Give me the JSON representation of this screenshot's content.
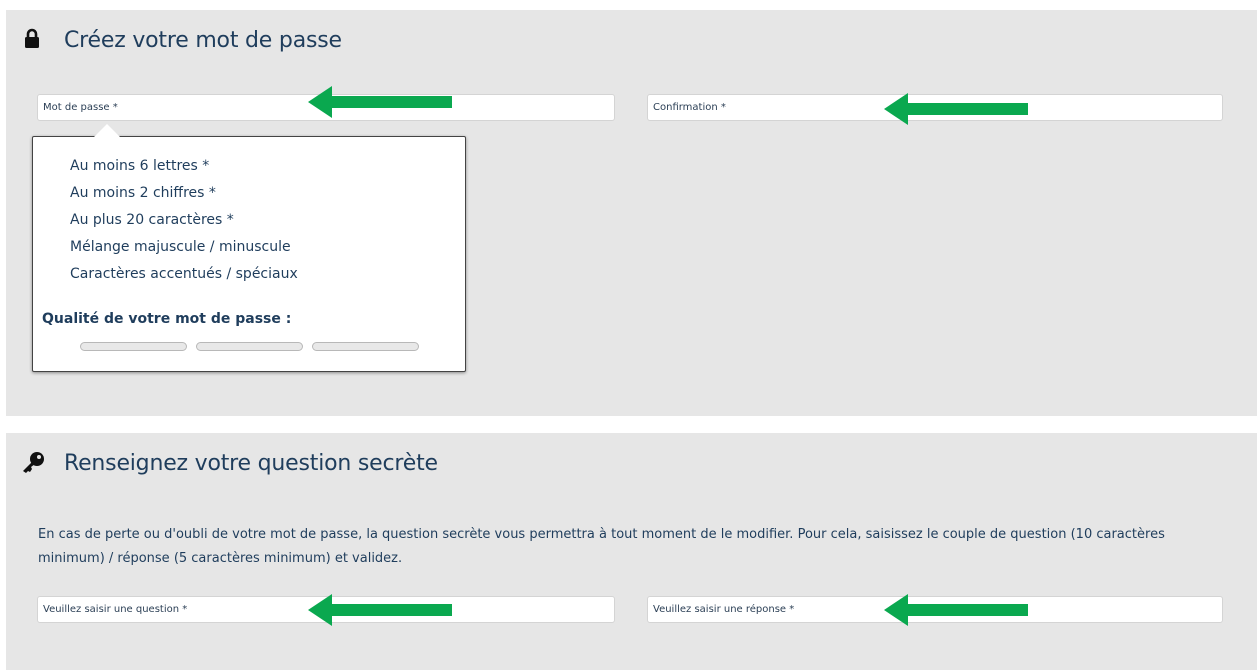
{
  "password_section": {
    "title": "Créez votre mot de passe",
    "icon": "lock-icon",
    "password_field": {
      "placeholder": "Mot de passe *",
      "value": ""
    },
    "confirmation_field": {
      "placeholder": "Confirmation *",
      "value": ""
    },
    "requirements": [
      "Au moins 6 lettres *",
      "Au moins 2 chiffres *",
      "Au plus 20 caractères *",
      "Mélange majuscule / minuscule",
      "Caractères accentués / spéciaux"
    ],
    "quality_label": "Qualité de votre mot de passe :",
    "quality_segments_filled": 0,
    "quality_segments_total": 3
  },
  "secret_section": {
    "title": "Renseignez votre question secrète",
    "icon": "key-icon",
    "description": "En cas de perte ou d'oubli de votre mot de passe, la question secrète vous permettra à tout moment de le modifier. Pour cela, saisissez le couple de question (10 caractères minimum) / réponse (5 caractères minimum) et validez.",
    "question_field": {
      "placeholder": "Veuillez saisir une question *",
      "value": ""
    },
    "answer_field": {
      "placeholder": "Veuillez saisir une réponse *",
      "value": ""
    }
  },
  "colors": {
    "panel_bg": "#e6e6e6",
    "title_text": "#1f3d5c",
    "arrow": "#0aa84f"
  },
  "arrow_icon": "left-arrow-icon"
}
